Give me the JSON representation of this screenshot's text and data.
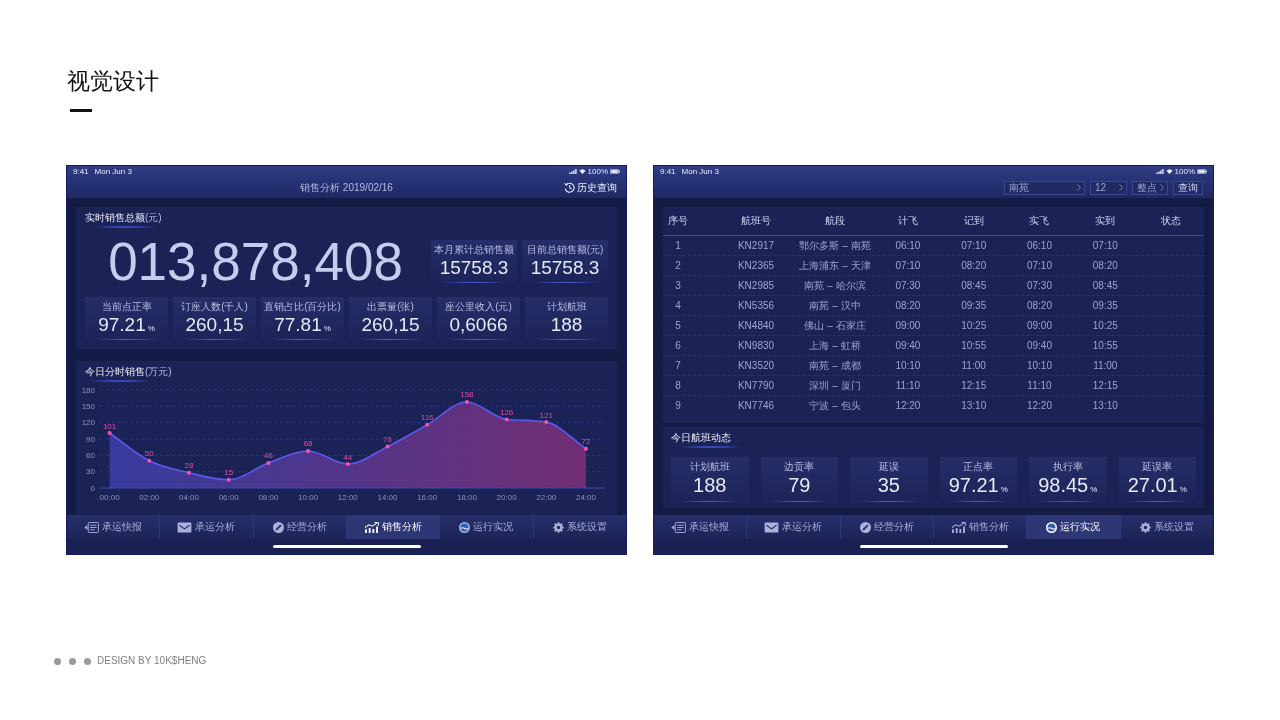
{
  "page_title": "视觉设计",
  "sales_screen": {
    "status_bar": {
      "time": "9:41",
      "date": "Mon Jun 3",
      "battery": "100%"
    },
    "nav_bar": {
      "title": "销售分析 2019/02/16",
      "history_button": "历史查询"
    },
    "total_sales": {
      "label": "实时销售总额",
      "unit": "(元)",
      "value": "013,878,408"
    },
    "side_stats": [
      {
        "label": "本月累计总销售额",
        "value": "15758.3"
      },
      {
        "label": "目前总销售额",
        "unit": "(元)",
        "value": "15758.3"
      }
    ],
    "kpis": [
      {
        "label": "当前点正率",
        "value": "97.21",
        "suffix": "%"
      },
      {
        "label": "订座人数",
        "unit": "(千人)",
        "value": "260,15"
      },
      {
        "label": "直销占比",
        "unit": "(百分比)",
        "value": "77.81",
        "suffix": "%"
      },
      {
        "label": "出票量",
        "unit": "(张)",
        "value": "260,15"
      },
      {
        "label": "座公里收入",
        "unit": "(元)",
        "value": "0,6066"
      },
      {
        "label": "计划航班",
        "value": "188"
      }
    ],
    "hourly_sales": {
      "title": "今日分时销售",
      "unit": "(万元)",
      "chart_data": {
        "type": "area",
        "categories": [
          "00:00",
          "02:00",
          "04:00",
          "06:00",
          "08:00",
          "10:00",
          "12:00",
          "14:00",
          "16:00",
          "18:00",
          "20:00",
          "22:00",
          "24:00"
        ],
        "values": [
          101,
          50,
          28,
          15,
          46,
          68,
          44,
          76,
          116,
          158,
          126,
          121,
          72
        ],
        "ylim": [
          0,
          180
        ],
        "yticks": [
          0,
          30,
          60,
          90,
          120,
          150,
          180
        ],
        "grid": true,
        "data_labels": true
      }
    },
    "tab_bar": [
      {
        "label": "承运快报",
        "selected": false
      },
      {
        "label": "承运分析",
        "selected": false
      },
      {
        "label": "经营分析",
        "selected": false
      },
      {
        "label": "销售分析",
        "selected": true
      },
      {
        "label": "运行实况",
        "selected": false
      },
      {
        "label": "系统设置",
        "selected": false
      }
    ]
  },
  "flights_screen": {
    "status_bar": {
      "time": "9:41",
      "date": "Mon Jun 3",
      "battery": "100%"
    },
    "nav_bar": {
      "filters": [
        {
          "value": "南苑"
        },
        {
          "value": "12"
        },
        {
          "value": "整点"
        }
      ],
      "query_button": "查询"
    },
    "flights_table": {
      "columns": [
        "序号",
        "航班号",
        "航段",
        "计飞",
        "记到",
        "实飞",
        "实到",
        "状态"
      ],
      "rows": [
        [
          "1",
          "KN2917",
          "鄂尔多斯 – 南苑",
          "06:10",
          "07:10",
          "06:10",
          "07:10"
        ],
        [
          "2",
          "KN2365",
          "上海浦东 – 天津",
          "07:10",
          "08:20",
          "07:10",
          "08:20"
        ],
        [
          "3",
          "KN2985",
          "南苑 – 哈尔滨",
          "07:30",
          "08:45",
          "07:30",
          "08:45"
        ],
        [
          "4",
          "KN5356",
          "南苑 – 汉中",
          "08:20",
          "09:35",
          "08:20",
          "09:35"
        ],
        [
          "5",
          "KN4840",
          "佛山 – 石家庄",
          "09:00",
          "10:25",
          "09:00",
          "10:25"
        ],
        [
          "6",
          "KN9830",
          "上海 – 虹桥",
          "09:40",
          "10:55",
          "09:40",
          "10:55"
        ],
        [
          "7",
          "KN3520",
          "南苑 – 成都",
          "10:10",
          "11:00",
          "10:10",
          "11:00"
        ],
        [
          "8",
          "KN7790",
          "深圳 – 厦门",
          "11:10",
          "12:15",
          "11:10",
          "12:15"
        ],
        [
          "9",
          "KN7746",
          "宁波 – 包头",
          "12:20",
          "13:10",
          "12:20",
          "13:10"
        ]
      ]
    },
    "flight_status": {
      "title": "今日航班动态",
      "kpis": [
        {
          "label": "计划航班",
          "value": "188"
        },
        {
          "label": "边贡率",
          "value": "79"
        },
        {
          "label": "延误",
          "value": "35"
        },
        {
          "label": "正点率",
          "value": "97.21",
          "suffix": "%"
        },
        {
          "label": "执行率",
          "value": "98.45",
          "suffix": "%"
        },
        {
          "label": "延误率",
          "value": "27.01",
          "suffix": "%"
        }
      ]
    },
    "tab_bar": [
      {
        "label": "承运快报",
        "selected": false
      },
      {
        "label": "承运分析",
        "selected": false
      },
      {
        "label": "经营分析",
        "selected": false
      },
      {
        "label": "销售分析",
        "selected": false
      },
      {
        "label": "运行实况",
        "selected": true
      },
      {
        "label": "系统设置",
        "selected": false
      }
    ]
  },
  "footer": {
    "credit": "DESIGN BY 10K$HENG"
  }
}
